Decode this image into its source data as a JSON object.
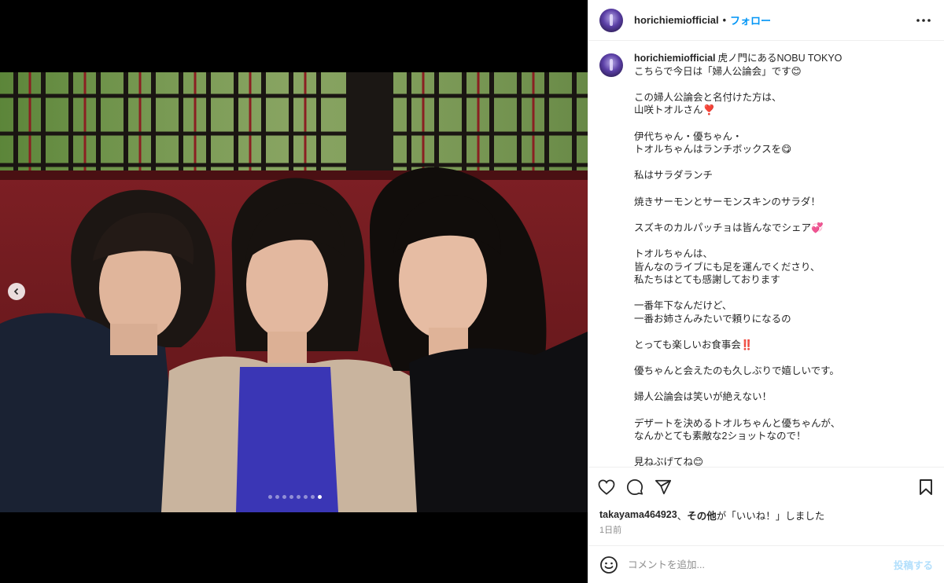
{
  "header": {
    "username": "horichiemiofficial",
    "separator": "•",
    "follow_label": "フォロー",
    "more_icon": "more-horizontal-icon"
  },
  "caption": {
    "author": "horichiemiofficial",
    "lines": [
      "虎ノ門にあるNOBU TOKYO",
      "こちらで今日は「婦人公論会」です😊",
      "",
      "この婦人公論会と名付けた方は、",
      "山咲トオルさん❣️",
      "",
      "伊代ちゃん・優ちゃん・",
      "トオルちゃんはランチボックスを😋",
      "",
      "私はサラダランチ",
      "",
      "焼きサーモンとサーモンスキンのサラダ！",
      "",
      "スズキのカルパッチョは皆んなでシェア💞",
      "",
      "トオルちゃんは、",
      "皆んなのライブにも足を運んでくださり、",
      "私たちはとても感謝しております",
      "",
      "一番年下なんだけど、",
      "一番お姉さんみたいで頼りになるの",
      "",
      "とっても楽しいお食事会‼️",
      "",
      "優ちゃんと会えたのも久しぶりで嬉しいです。",
      "",
      "婦人公論会は笑いが絶えない！",
      "",
      "デザートを決めるトオルちゃんと優ちゃんが、",
      "なんかとても素敵な2ショットなので！",
      "",
      "見ねぶげてね😊"
    ]
  },
  "actions": {
    "like_icon": "heart-icon",
    "comment_icon": "comment-icon",
    "share_icon": "send-icon",
    "save_icon": "bookmark-icon"
  },
  "likes": {
    "user": "takayama464923",
    "sep": "、",
    "others": "その他",
    "suffix": "が「いいね！」しました"
  },
  "timestamp": "1日前",
  "comment": {
    "emoji_icon": "emoji-icon",
    "placeholder": "コメントを追加...",
    "post_label": "投稿する"
  },
  "carousel": {
    "prev_icon": "chevron-left-icon",
    "total": 8,
    "active_index": 7
  },
  "colors": {
    "accent": "#0095f6",
    "post_disabled": "#b2dffc",
    "muted": "#8e8e8e"
  }
}
